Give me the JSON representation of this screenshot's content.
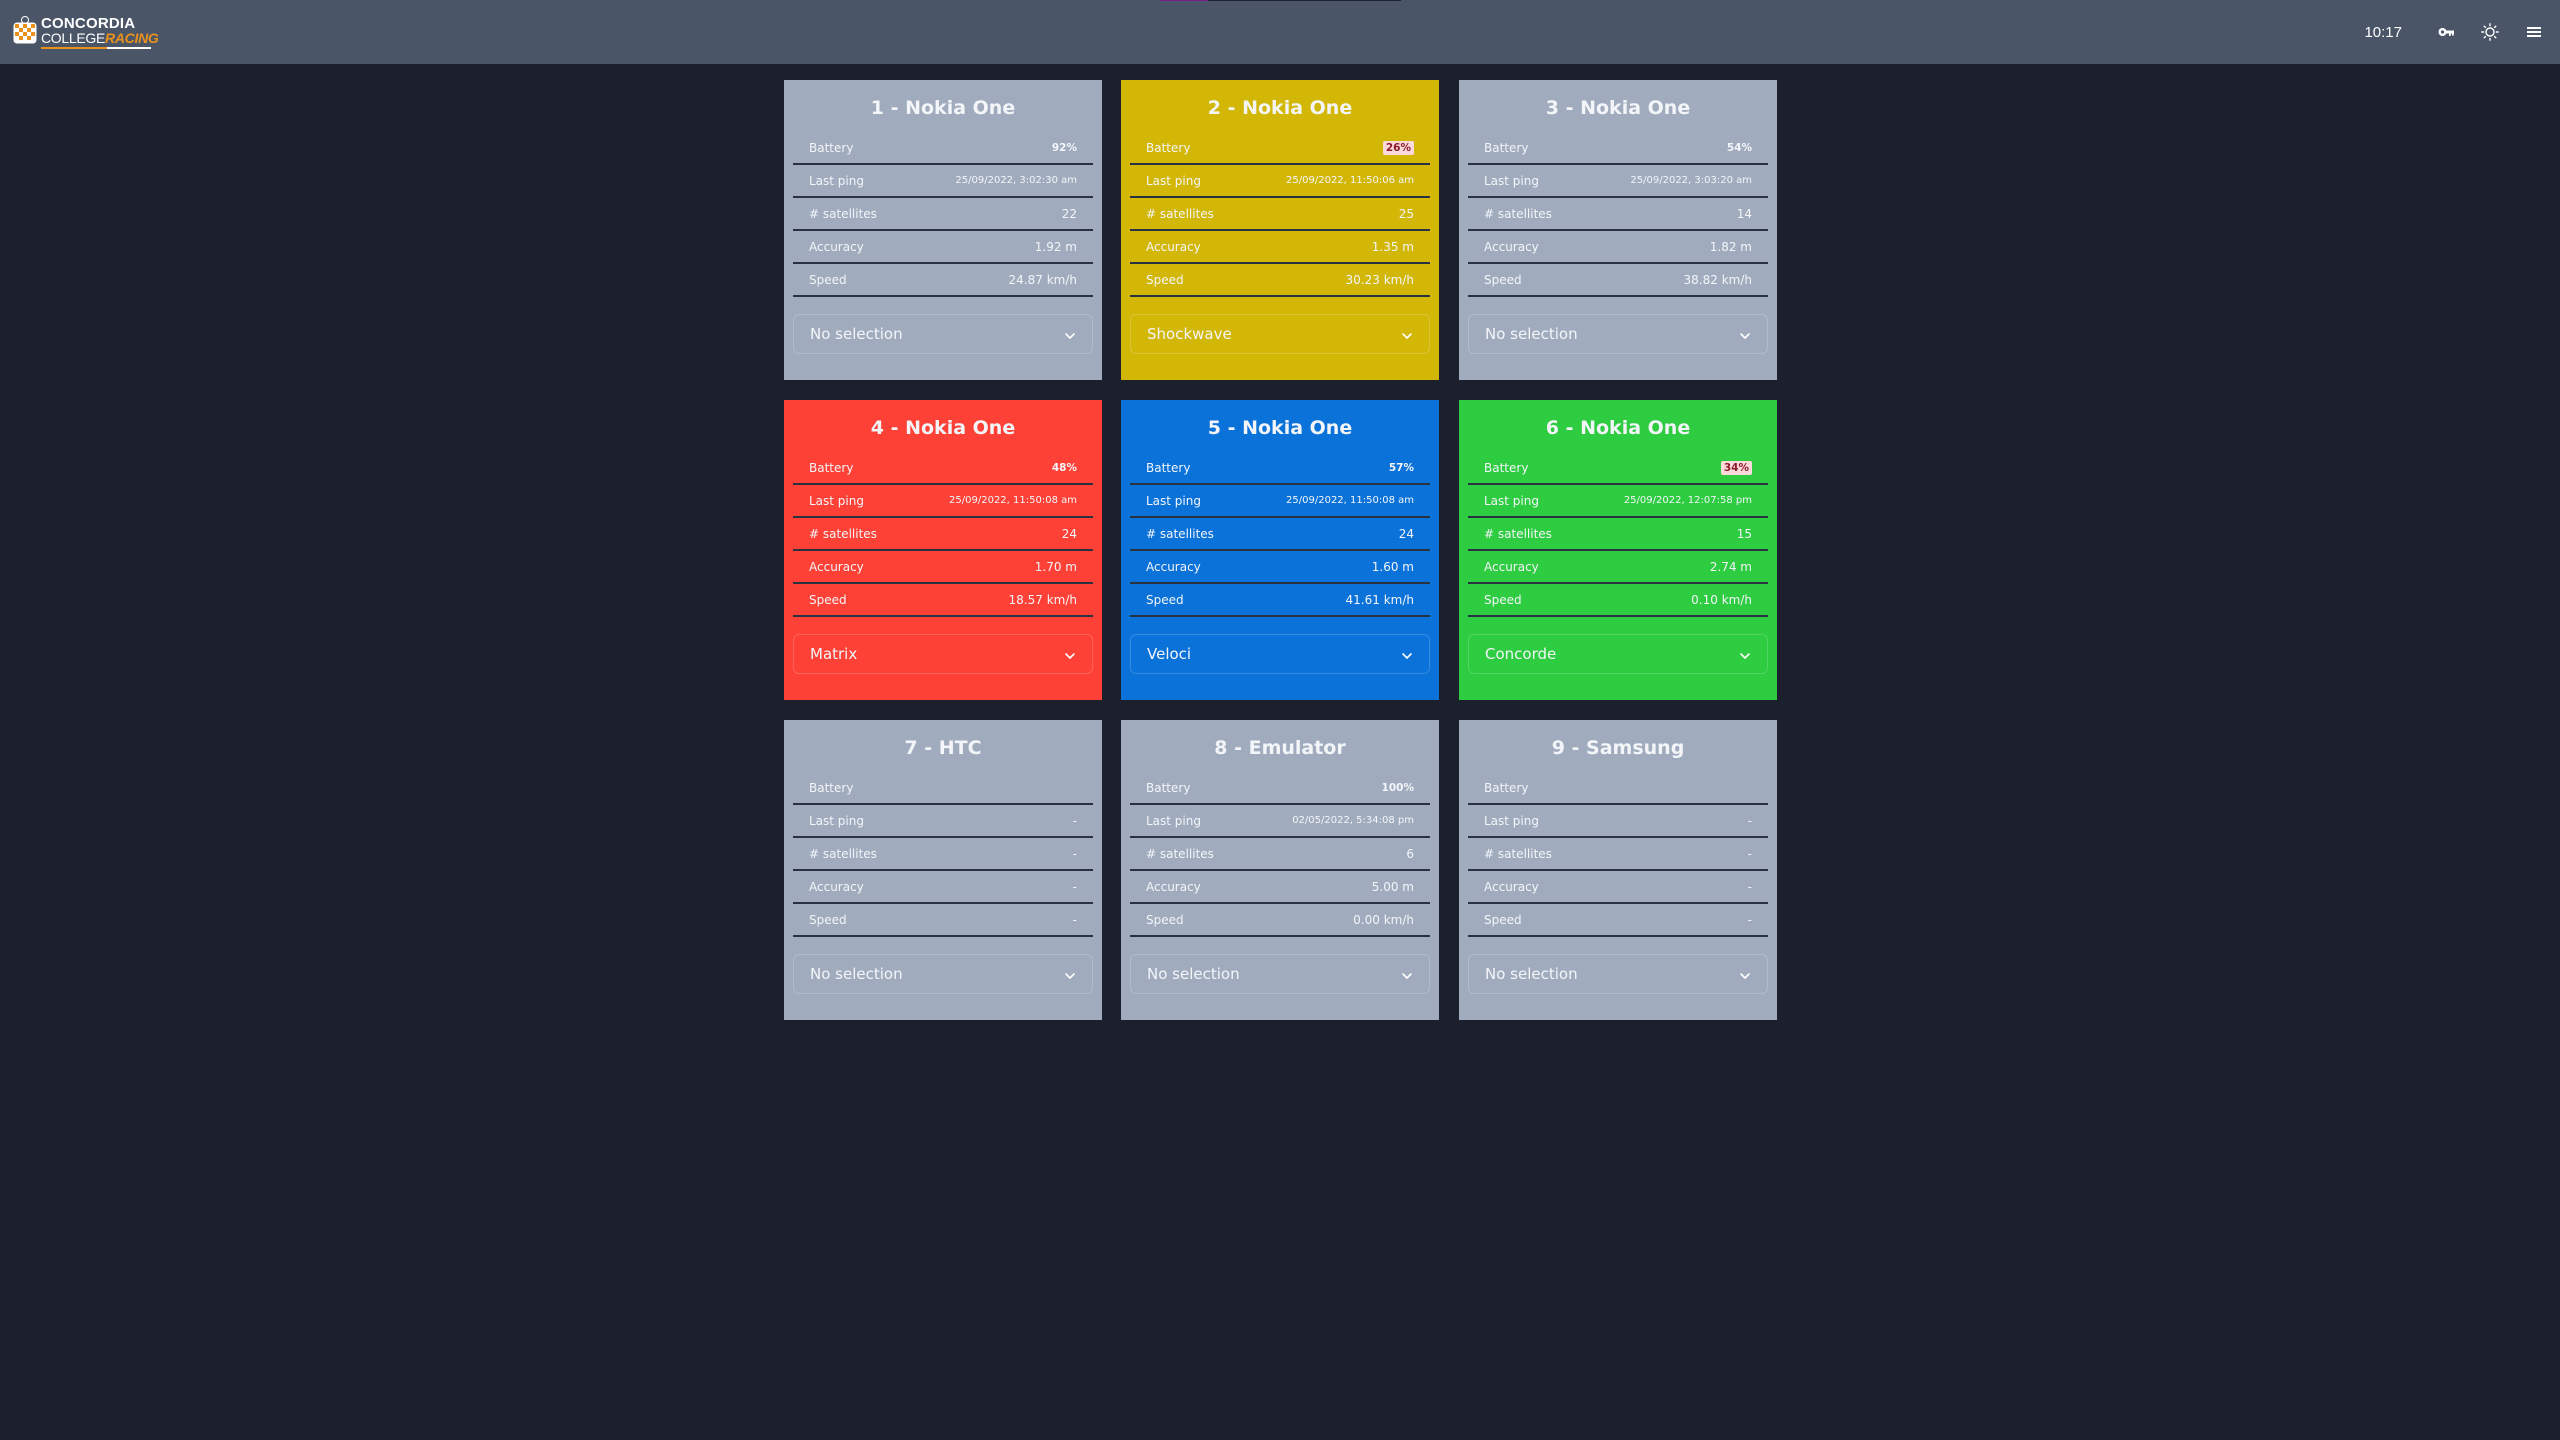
{
  "header": {
    "logo": {
      "line1": "CONCORDIA",
      "line2_main": "COLLEGE",
      "line2_accent": "RACING"
    },
    "clock": "10:17",
    "progress": 0.2,
    "icons": {
      "key": "key-icon",
      "theme": "sun-icon",
      "menu": "hamburger-menu-icon"
    }
  },
  "labels": {
    "battery": "Battery",
    "last_ping": "Last ping",
    "satellites": "# satellites",
    "accuracy": "Accuracy",
    "speed": "Speed"
  },
  "colors": {
    "gray": "#a0acbd",
    "yellow": "#d2b707",
    "red": "#fe4136",
    "blue": "#0a72d9",
    "green": "#2ecc40",
    "background": "#1b202c",
    "header": "#4a5568",
    "low_battery_badge_bg": "#fcd9db",
    "low_battery_badge_fg": "#8c1b2a"
  },
  "devices": [
    {
      "title": "1 - Nokia One",
      "color": "gray",
      "battery": "92%",
      "battery_low": false,
      "last_ping": "25/09/2022, 3:02:30 am",
      "satellites": "22",
      "accuracy": "1.92 m",
      "speed": "24.87 km/h",
      "selection": "No selection"
    },
    {
      "title": "2 - Nokia One",
      "color": "yellow",
      "battery": "26%",
      "battery_low": true,
      "last_ping": "25/09/2022, 11:50:06 am",
      "satellites": "25",
      "accuracy": "1.35 m",
      "speed": "30.23 km/h",
      "selection": "Shockwave"
    },
    {
      "title": "3 - Nokia One",
      "color": "gray",
      "battery": "54%",
      "battery_low": false,
      "last_ping": "25/09/2022, 3:03:20 am",
      "satellites": "14",
      "accuracy": "1.82 m",
      "speed": "38.82 km/h",
      "selection": "No selection"
    },
    {
      "title": "4 - Nokia One",
      "color": "red",
      "battery": "48%",
      "battery_low": false,
      "last_ping": "25/09/2022, 11:50:08 am",
      "satellites": "24",
      "accuracy": "1.70 m",
      "speed": "18.57 km/h",
      "selection": "Matrix"
    },
    {
      "title": "5 - Nokia One",
      "color": "blue",
      "battery": "57%",
      "battery_low": false,
      "last_ping": "25/09/2022, 11:50:08 am",
      "satellites": "24",
      "accuracy": "1.60 m",
      "speed": "41.61 km/h",
      "selection": "Veloci"
    },
    {
      "title": "6 - Nokia One",
      "color": "green",
      "battery": "34%",
      "battery_low": true,
      "last_ping": "25/09/2022, 12:07:58 pm",
      "satellites": "15",
      "accuracy": "2.74 m",
      "speed": "0.10 km/h",
      "selection": "Concorde"
    },
    {
      "title": "7 - HTC",
      "color": "gray",
      "battery": "",
      "battery_low": false,
      "last_ping": "-",
      "satellites": "-",
      "accuracy": "-",
      "speed": "-",
      "selection": "No selection"
    },
    {
      "title": "8 - Emulator",
      "color": "gray",
      "battery": "100%",
      "battery_low": false,
      "last_ping": "02/05/2022, 5:34:08 pm",
      "satellites": "6",
      "accuracy": "5.00 m",
      "speed": "0.00 km/h",
      "selection": "No selection"
    },
    {
      "title": "9 - Samsung",
      "color": "gray",
      "battery": "",
      "battery_low": false,
      "last_ping": "-",
      "satellites": "-",
      "accuracy": "-",
      "speed": "-",
      "selection": "No selection"
    }
  ]
}
